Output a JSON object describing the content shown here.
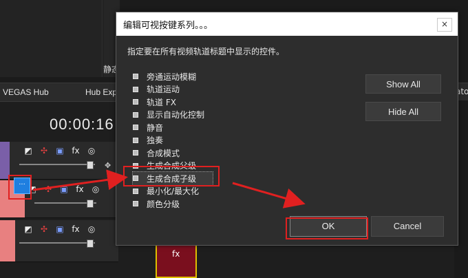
{
  "background": {
    "panel_label": "静态",
    "tabs": [
      "VEGAS Hub",
      "Hub Exp",
      "ator"
    ],
    "timecode": "00:00:16",
    "track_controls": {
      "fx_label": "fx",
      "more_label": "···",
      "clip_fx_label": "fx"
    }
  },
  "dialog": {
    "title": "编辑可视按键系列。。。",
    "close_label": "×",
    "instruction": "指定要在所有视频轨道标题中显示的控件。",
    "items": [
      {
        "label": "旁通运动模糊",
        "selected": false
      },
      {
        "label": "轨道运动",
        "selected": false
      },
      {
        "label": "轨道 FX",
        "selected": false
      },
      {
        "label": "显示自动化控制",
        "selected": false
      },
      {
        "label": "静音",
        "selected": false
      },
      {
        "label": "独奏",
        "selected": false
      },
      {
        "label": "合成模式",
        "selected": false
      },
      {
        "label": "生成合成父级",
        "selected": false
      },
      {
        "label": "生成合成子级",
        "selected": true
      },
      {
        "label": "最小化/最大化",
        "selected": false
      },
      {
        "label": "颜色分级",
        "selected": false
      }
    ],
    "show_all_label": "Show All",
    "hide_all_label": "Hide All",
    "ok_label": "OK",
    "cancel_label": "Cancel"
  },
  "colors": {
    "annotation_red": "#e02020",
    "track_purple": "#7a5fa8",
    "track_salmon": "#e88080",
    "accent_blue": "#1f7fe0"
  }
}
